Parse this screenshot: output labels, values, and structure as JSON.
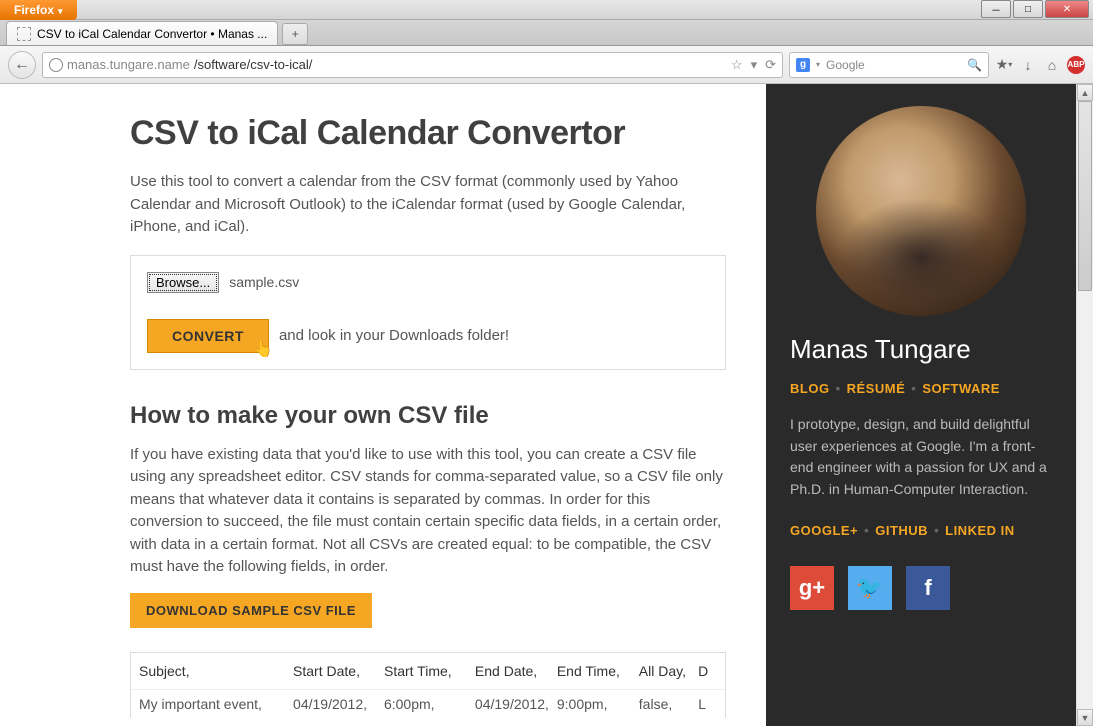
{
  "chrome": {
    "firefox_label": "Firefox",
    "win_min": "－",
    "win_max": "□",
    "win_close": "✕",
    "tab_title": "CSV to iCal Calendar Convertor • Manas ...",
    "new_tab": "+",
    "back_arrow": "←",
    "url_host": "manas.tungare.name",
    "url_path": "/software/csv-to-ical/",
    "star": "☆",
    "dropdown": "▾",
    "refresh": "⟳",
    "search_engine_letter": "g",
    "search_placeholder": "Google",
    "search_icon": "🔍",
    "bookmark_icon": "▾",
    "download_icon": "↓",
    "home_icon": "⌂",
    "abp_label": "ABP"
  },
  "page": {
    "title": "CSV to iCal Calendar Convertor",
    "intro": "Use this tool to convert a calendar from the CSV format (commonly used by Yahoo Calendar and Microsoft Outlook) to the iCalendar format (used by Google Calendar, iPhone, and iCal).",
    "browse_label": "Browse...",
    "file_name": "sample.csv",
    "convert_label": "CONVERT",
    "convert_hint": "and look in your Downloads folder!",
    "howto_heading": "How to make your own CSV file",
    "howto_body": "If you have existing data that you'd like to use with this tool, you can create a CSV file using any spreadsheet editor. CSV stands for comma-separated value, so a CSV file only means that whatever data it contains is separated by commas. In order for this conversion to succeed, the file must contain certain specific data fields, in a certain order, with data in a certain format. Not all CSVs are created equal: to be compatible, the CSV must have the following fields, in order.",
    "download_label": "DOWNLOAD SAMPLE CSV FILE",
    "table": {
      "headers": [
        "Subject,",
        "Start Date,",
        "Start Time,",
        "End Date,",
        "End Time,",
        "All Day,",
        "D"
      ],
      "row": [
        "My important event,",
        "04/19/2012,",
        "6:00pm,",
        "04/19/2012,",
        "9:00pm,",
        "false,",
        "L"
      ]
    }
  },
  "sidebar": {
    "name": "Manas Tungare",
    "nav": {
      "blog": "BLOG",
      "resume": "RÉSUMÉ",
      "software": "SOFTWARE"
    },
    "bio": "I prototype, design, and build delightful user experiences at Google. I'm a front-end engineer with a passion for UX and a Ph.D. in Human-Computer Interaction.",
    "social_nav": {
      "gplus": "GOOGLE+",
      "github": "GITHUB",
      "linkedin": "LINKED IN"
    },
    "social_icons": {
      "gp": "g+",
      "tw": "🐦",
      "fb": "f"
    }
  },
  "scroll": {
    "up": "▲",
    "down": "▼"
  }
}
